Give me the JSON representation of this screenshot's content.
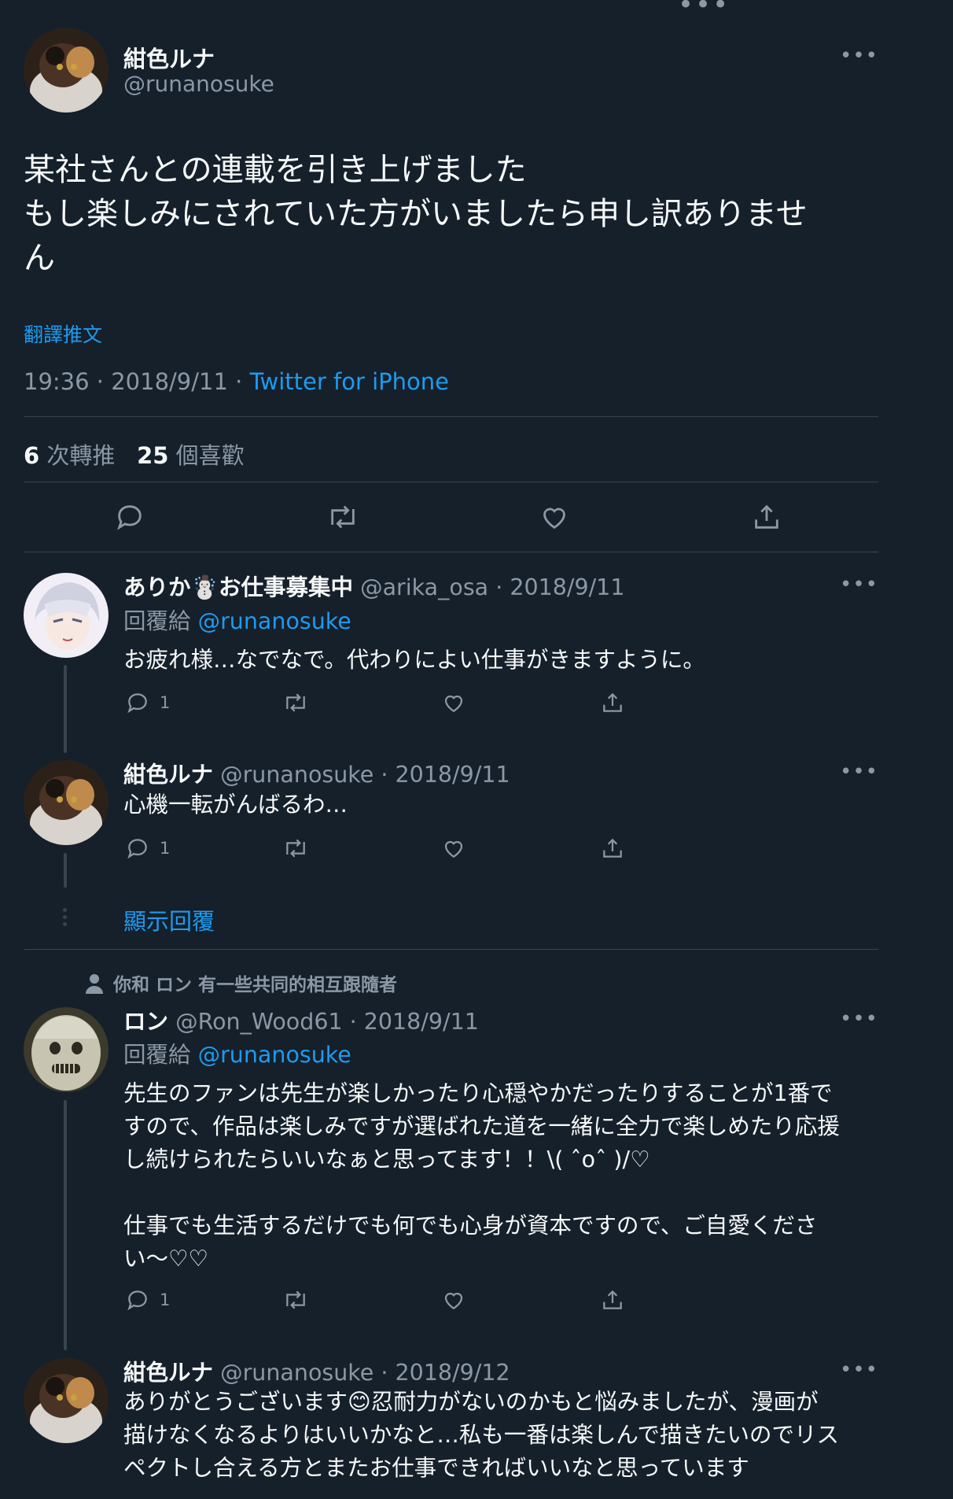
{
  "main_tweet": {
    "display_name": "紺色ルナ",
    "handle": "@runanosuke",
    "text_lines": [
      "某社さんとの連載を引き上げました",
      "もし楽しみにされていた方がいましたら申し訳ありませ",
      "ん"
    ],
    "translate_label": "翻譯推文",
    "time": "19:36 · 2018/9/11 · ",
    "source": "Twitter for iPhone",
    "retweet_count": "6",
    "retweet_label": "次轉推",
    "like_count": "25",
    "like_label": "個喜歡"
  },
  "replies": [
    {
      "display_name": "ありか☃️お仕事募集中",
      "handle": "@arika_osa",
      "date": " · 2018/9/11",
      "replying_to_label": "回覆給",
      "replying_to": "@runanosuke",
      "text_lines": [
        "お疲れ様…なでなで。代わりによい仕事がきますように。"
      ],
      "reply_count": "1"
    },
    {
      "display_name": "紺色ルナ",
      "handle": "@runanosuke",
      "date": " · 2018/9/11",
      "text_lines": [
        "心機一転がんばるわ…"
      ],
      "reply_count": "1"
    },
    {
      "social_context": "你和 ロン 有一些共同的相互跟隨者",
      "display_name": "ロン",
      "handle": "@Ron_Wood61",
      "date": " · 2018/9/11",
      "replying_to_label": "回覆給",
      "replying_to": "@runanosuke",
      "text_lines": [
        "先生のファンは先生が楽しかったり心穏やかだったりすることが1番で",
        "すので、作品は楽しみですが選ばれた道を一緒に全力で楽しめたり応援",
        "し続けられたらいいなぁと思ってます！！\\( ˆoˆ )/♡",
        "",
        "仕事でも生活するだけでも何でも心身が資本ですので、ご自愛くださ",
        "い〜♡♡"
      ],
      "reply_count": "1"
    },
    {
      "display_name": "紺色ルナ",
      "handle": "@runanosuke",
      "date": " · 2018/9/12",
      "text_lines": [
        "ありがとうございます😊忍耐力がないのかもと悩みましたが、漫画が",
        "描けなくなるよりはいいかなと…私も一番は楽しんで描きたいのでリス",
        "ペクトし合える方とまたお仕事できればいいなと思っています"
      ]
    }
  ],
  "show_replies_label": "顯示回覆",
  "icons": [
    "more-icon",
    "reply-icon",
    "retweet-icon",
    "like-icon",
    "share-icon",
    "person-icon",
    "thread-dots-icon"
  ],
  "colors": {
    "background": "#15202b",
    "accent": "#1d9bf0",
    "muted": "#8b98a5",
    "divider": "#38444d"
  }
}
